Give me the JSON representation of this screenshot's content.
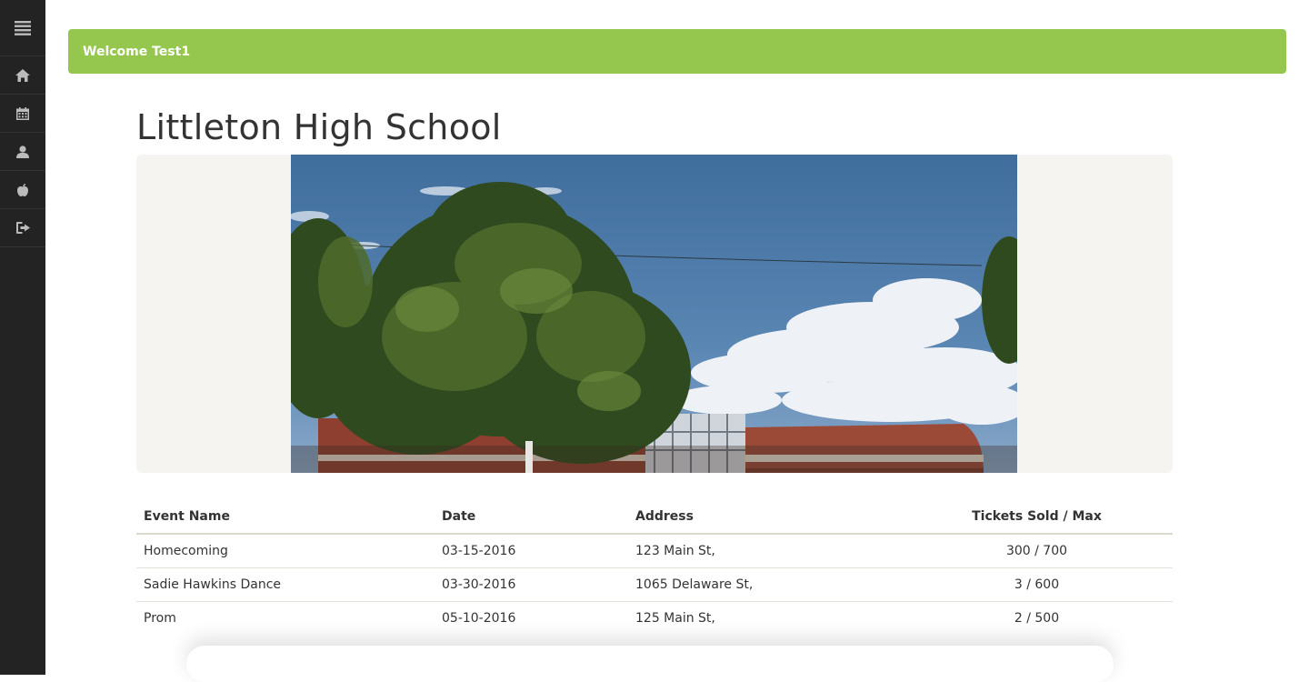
{
  "sidebar": {
    "items": [
      {
        "icon": "menu-icon"
      },
      {
        "icon": "home-icon"
      },
      {
        "icon": "calendar-icon"
      },
      {
        "icon": "user-icon"
      },
      {
        "icon": "apple-icon"
      },
      {
        "icon": "logout-icon"
      }
    ]
  },
  "header": {
    "welcome": "Welcome Test1"
  },
  "colors": {
    "accent": "#95c64e",
    "sidebar": "#232323",
    "jumbotron": "#f6f4f0"
  },
  "school": {
    "name": "Littleton High School"
  },
  "events": {
    "columns": [
      "Event Name",
      "Date",
      "Address",
      "Tickets Sold / Max"
    ],
    "rows": [
      {
        "name": "Homecoming",
        "date": "03-15-2016",
        "address": "123 Main St,",
        "tickets": "300 / 700"
      },
      {
        "name": "Sadie Hawkins Dance",
        "date": "03-30-2016",
        "address": "1065 Delaware St,",
        "tickets": "3 / 600"
      },
      {
        "name": "Prom",
        "date": "05-10-2016",
        "address": "125 Main St,",
        "tickets": "2 / 500"
      }
    ]
  }
}
